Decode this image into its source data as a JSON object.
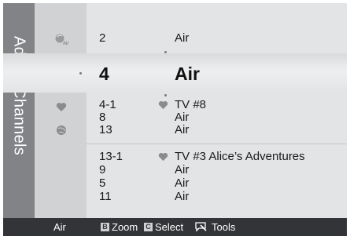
{
  "menu": {
    "title": "Added Channels"
  },
  "top_row": {
    "number": "2",
    "name": "Air"
  },
  "selected": {
    "number": "4",
    "name": "Air"
  },
  "channels": [
    {
      "number": "4-1",
      "name": "TV #8",
      "favorite": true
    },
    {
      "number": "8",
      "name": "Air",
      "favorite": false
    },
    {
      "number": "13",
      "name": "Air",
      "favorite": false
    },
    {
      "number": "13-1",
      "name": "TV #3 Alice’s Adventures",
      "favorite": true
    },
    {
      "number": "9",
      "name": "Air",
      "favorite": false
    },
    {
      "number": "5",
      "name": "Air",
      "favorite": false
    },
    {
      "number": "11",
      "name": "Air",
      "favorite": false
    }
  ],
  "icons": {
    "antenna": "antenna-air-icon",
    "add": "add-channel-icon",
    "favorite": "favorite-heart-icon",
    "globe": "globe-icon"
  },
  "footer": {
    "source": "Air",
    "zoom_key": "B",
    "zoom_label": "Zoom",
    "select_key": "C",
    "select_label": "Select",
    "tools_label": "Tools"
  },
  "colors": {
    "side_tab": "#818386",
    "icon_column": "#d1d2d3",
    "list_bg": "#e3e4e5",
    "footer_bg": "#323437",
    "heart": "#8a8b8d"
  }
}
